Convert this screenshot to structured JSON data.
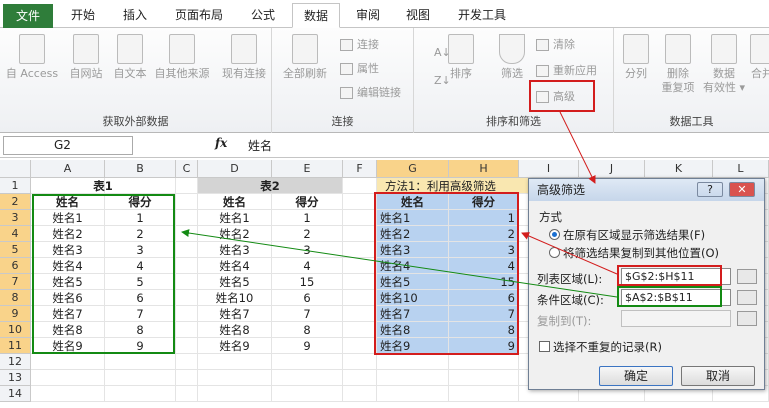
{
  "ribbon": {
    "tabs": [
      "文件",
      "开始",
      "插入",
      "页面布局",
      "公式",
      "数据",
      "审阅",
      "视图",
      "开发工具"
    ],
    "active_tab": "数据",
    "groups": {
      "external": {
        "label": "获取外部数据",
        "buttons": [
          "自 Access",
          "自网站",
          "自文本",
          "自其他来源",
          "现有连接"
        ]
      },
      "connections": {
        "label": "连接",
        "refresh": "全部刷新",
        "items": [
          "连接",
          "属性",
          "编辑链接"
        ]
      },
      "sort_filter": {
        "label": "排序和筛选",
        "sort": "排序",
        "filter": "筛选",
        "clear": "清除",
        "reapply": "重新应用",
        "advanced": "高级"
      },
      "data_tools": {
        "label": "数据工具",
        "buttons": [
          "分列",
          "删除\n重复项",
          "数据\n有效性 ▾",
          "合并"
        ]
      }
    }
  },
  "formula_bar": {
    "name_box": "G2",
    "fx": "fx",
    "formula": "姓名"
  },
  "grid": {
    "columns": [
      "A",
      "B",
      "C",
      "D",
      "E",
      "F",
      "G",
      "H",
      "I",
      "J",
      "K",
      "L"
    ],
    "rows": [
      "1",
      "2",
      "3",
      "4",
      "5",
      "6",
      "7",
      "8",
      "9",
      "10",
      "11",
      "12",
      "13",
      "14"
    ],
    "table1": {
      "title": "表1",
      "headers": [
        "姓名",
        "得分"
      ],
      "rows": [
        [
          "姓名1",
          "1"
        ],
        [
          "姓名2",
          "2"
        ],
        [
          "姓名3",
          "3"
        ],
        [
          "姓名4",
          "4"
        ],
        [
          "姓名5",
          "5"
        ],
        [
          "姓名6",
          "6"
        ],
        [
          "姓名7",
          "7"
        ],
        [
          "姓名8",
          "8"
        ],
        [
          "姓名9",
          "9"
        ]
      ]
    },
    "table2": {
      "title": "表2",
      "headers": [
        "姓名",
        "得分"
      ],
      "rows": [
        [
          "姓名1",
          "1"
        ],
        [
          "姓名2",
          "2"
        ],
        [
          "姓名3",
          "3"
        ],
        [
          "姓名4",
          "4"
        ],
        [
          "姓名5",
          "15"
        ],
        [
          "姓名10",
          "6"
        ],
        [
          "姓名7",
          "7"
        ],
        [
          "姓名8",
          "8"
        ],
        [
          "姓名9",
          "9"
        ]
      ]
    },
    "table3": {
      "title": "方法1：利用高级筛选",
      "headers": [
        "姓名",
        "得分"
      ],
      "rows": [
        [
          "姓名1",
          "1"
        ],
        [
          "姓名2",
          "2"
        ],
        [
          "姓名3",
          "3"
        ],
        [
          "姓名4",
          "4"
        ],
        [
          "姓名5",
          "15"
        ],
        [
          "姓名10",
          "6"
        ],
        [
          "姓名7",
          "7"
        ],
        [
          "姓名8",
          "8"
        ],
        [
          "姓名9",
          "9"
        ]
      ]
    }
  },
  "dialog": {
    "title": "高级筛选",
    "help": "?",
    "close": "✕",
    "section": "方式",
    "option1": "在原有区域显示筛选结果(F)",
    "option2": "将筛选结果复制到其他位置(O)",
    "list_range_label": "列表区域(L):",
    "list_range_value": "$G$2:$H$11",
    "criteria_label": "条件区域(C):",
    "criteria_value": "$A$2:$B$11",
    "copy_to_label": "复制到(T):",
    "copy_to_value": "",
    "unique_label": "选择不重复的记录(R)",
    "ok": "确定",
    "cancel": "取消"
  },
  "colors": {
    "file_tab": "#2f7d3a",
    "selection": "#b8d2f0",
    "highlight_red": "#d31d1d",
    "highlight_green": "#138a13"
  }
}
